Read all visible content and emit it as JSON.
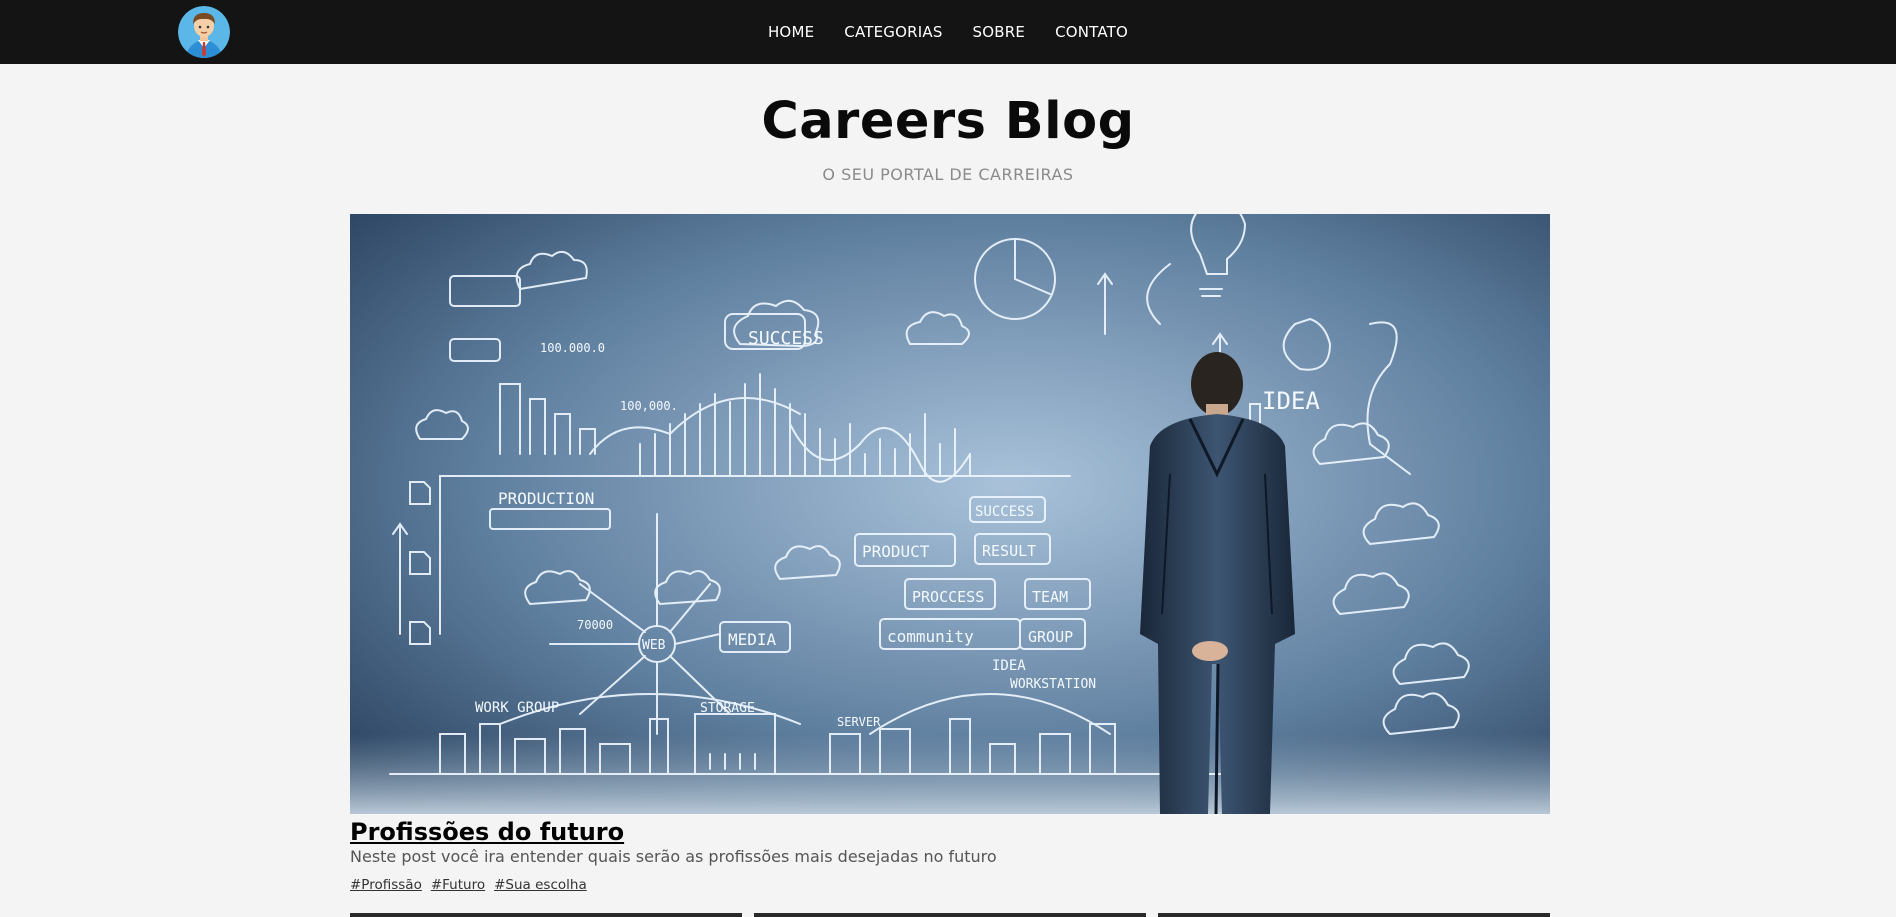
{
  "header": {
    "nav": [
      {
        "label": "HOME"
      },
      {
        "label": "CATEGORIAS"
      },
      {
        "label": "SOBRE"
      },
      {
        "label": "CONTATO"
      }
    ]
  },
  "brand": {
    "title": "Careers Blog",
    "subtitle": "O SEU PORTAL DE CARREIRAS"
  },
  "featured_post": {
    "title": "Profissões do futuro",
    "description": "Neste post você ira entender quais serão as profissões mais desejadas no futuro",
    "tags": [
      "#Profissão",
      "#Futuro",
      "#Sua escolha"
    ],
    "image_text": {
      "success": "SUCCESS",
      "production": "PRODUCTION",
      "product": "PRODUCT",
      "process": "PROCCESS",
      "community": "community",
      "result": "RESULT",
      "success2": "SUCCESS",
      "team": "TEAM",
      "group": "GROUP",
      "media": "MEDIA",
      "web": "WEB",
      "idea": "IDEA",
      "idea2": "IDEA",
      "workstation": "WORKSTATION",
      "workgroup": "WORK GROUP",
      "storage": "STORAGE",
      "server": "SERVER",
      "n1": "100.000.0",
      "n2": "100,000.",
      "n3": "70000"
    }
  },
  "colors": {
    "topbar": "#141414",
    "page_bg": "#f4f4f4",
    "subtitle": "#8a8a8a"
  }
}
